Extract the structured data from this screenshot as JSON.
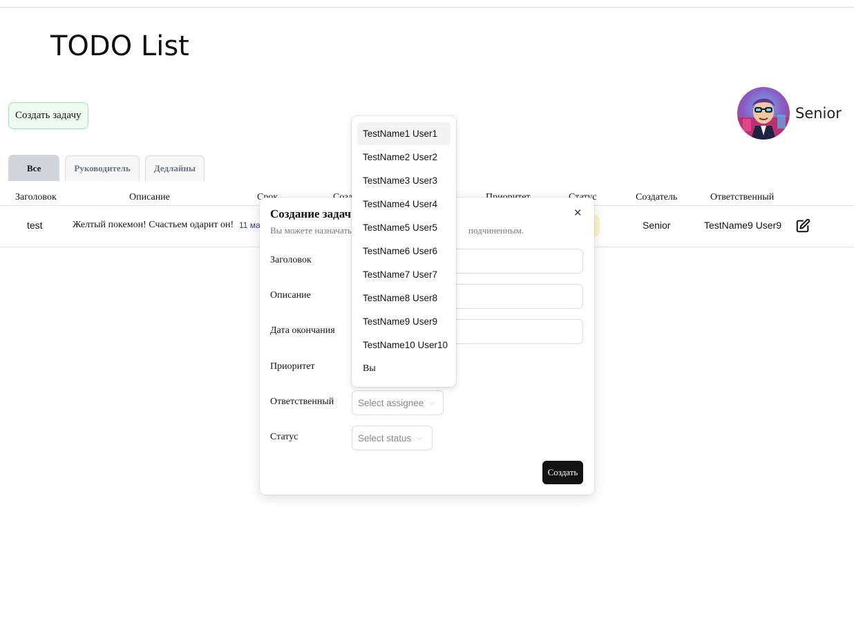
{
  "app": {
    "title": "TODO List"
  },
  "toolbar": {
    "create_task_label": "Создать задачу"
  },
  "user": {
    "name": "Senior",
    "avatar_icon": "avatar-cartoon-icon"
  },
  "tabs": [
    {
      "label": "Все",
      "active": true
    },
    {
      "label": "Руководитель",
      "active": false
    },
    {
      "label": "Дедлайны",
      "active": false
    }
  ],
  "table": {
    "headers": [
      "Заголовок",
      "Описание",
      "Срок",
      "Созд",
      "Приоритет",
      "Статус",
      "Создатель",
      "Ответственный"
    ],
    "rows": [
      {
        "title": "test",
        "description": "Желтый покемон! Счастьем одарит он!",
        "deadline": "11 ма",
        "creator": "Senior",
        "assignee": "TestName9 User9",
        "edit_icon": "edit-icon"
      }
    ]
  },
  "modal": {
    "title": "Создание задач",
    "description_left": "Вы можете назначать",
    "description_right": "подчиненным.",
    "close_glyph": "✕",
    "fields": {
      "title_label": "Заголовок",
      "description_label": "Описание",
      "deadline_label": "Дата окончания",
      "priority_label": "Приоритет",
      "assignee_label": "Ответственный",
      "assignee_placeholder": "Select assignee",
      "status_label": "Статус",
      "status_placeholder": "Select status"
    },
    "submit_label": "Создать"
  },
  "assignee_dropdown": {
    "highlighted_index": 0,
    "options": [
      "TestName1 User1",
      "TestName2 User2",
      "TestName3 User3",
      "TestName4 User4",
      "TestName5 User5",
      "TestName6 User6",
      "TestName7 User7",
      "TestName8 User8",
      "TestName9 User9",
      "TestName10 User10",
      "Вы"
    ]
  }
}
